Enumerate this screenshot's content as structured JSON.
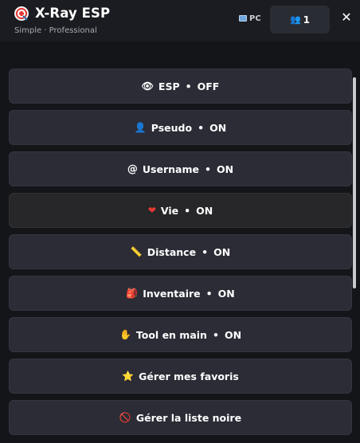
{
  "header": {
    "title": "X-Ray ESP",
    "subtitle": "Simple · Professional",
    "platform_label": "PC",
    "user_count": "1",
    "close_label": "✕"
  },
  "options": [
    {
      "icon": "eye-icon",
      "glyph": "👁",
      "label": "ESP",
      "state": "OFF"
    },
    {
      "icon": "user-icon",
      "glyph": "👤",
      "label": "Pseudo",
      "state": "ON"
    },
    {
      "icon": "at-icon",
      "glyph": "@",
      "label": "Username",
      "state": "ON"
    },
    {
      "icon": "heart-icon",
      "glyph": "❤",
      "label": "Vie",
      "state": "ON"
    },
    {
      "icon": "ruler-icon",
      "glyph": "📏",
      "label": "Distance",
      "state": "ON"
    },
    {
      "icon": "backpack-icon",
      "glyph": "🎒",
      "label": "Inventaire",
      "state": "ON"
    },
    {
      "icon": "hand-icon",
      "glyph": "✋",
      "label": "Tool en main",
      "state": "ON"
    }
  ],
  "actions": [
    {
      "icon": "star-icon",
      "glyph": "⭐",
      "label": "Gérer mes favoris"
    },
    {
      "icon": "forbidden-icon",
      "glyph": "🚫",
      "label": "Gérer la liste noire"
    }
  ],
  "separator": "•",
  "colors": {
    "background": "#141519",
    "button": "#2b2c35",
    "heart": "#e53935",
    "star": "#f5b800",
    "forbidden": "#e53935"
  }
}
